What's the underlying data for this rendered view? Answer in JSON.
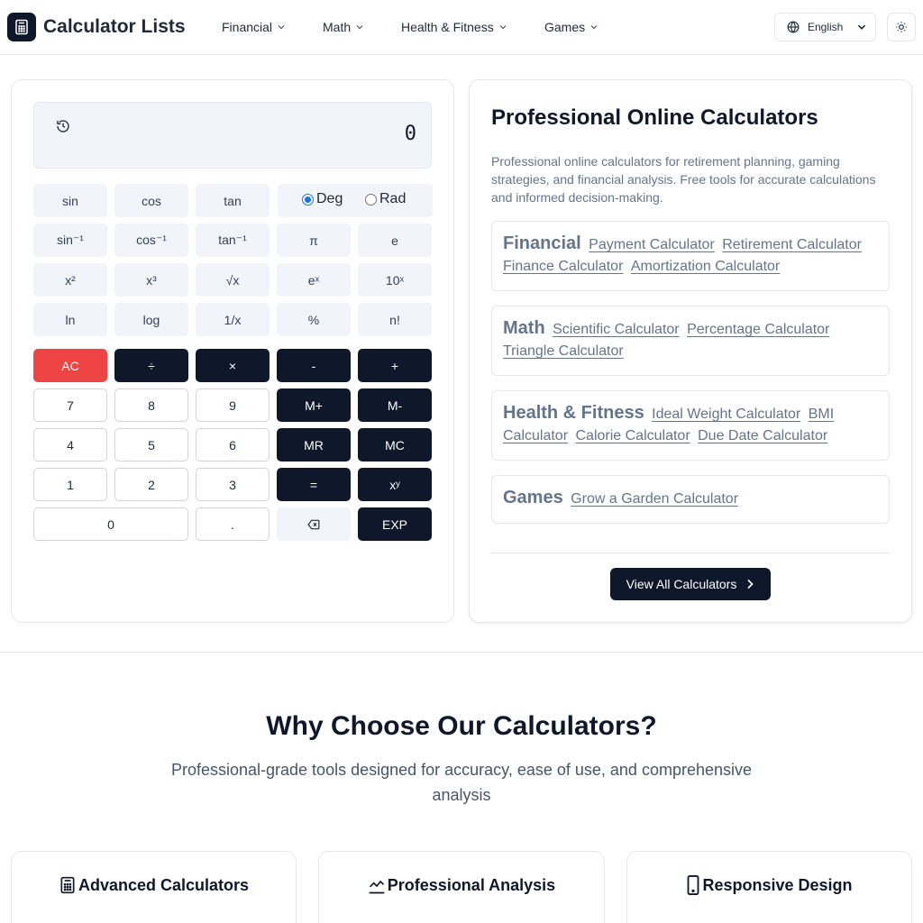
{
  "header": {
    "brand": "Calculator Lists",
    "nav": [
      {
        "label": "Financial"
      },
      {
        "label": "Math"
      },
      {
        "label": "Health & Fitness"
      },
      {
        "label": "Games"
      }
    ],
    "language": "English"
  },
  "calculator": {
    "display": "0",
    "angle_modes": {
      "deg": "Deg",
      "rad": "Rad",
      "selected": "Deg"
    },
    "keys": {
      "sin": "sin",
      "cos": "cos",
      "tan": "tan",
      "asin": "sin⁻¹",
      "acos": "cos⁻¹",
      "atan": "tan⁻¹",
      "pi": "π",
      "e": "e",
      "sq": "x²",
      "cube": "x³",
      "sqrt": "√x",
      "exp_e": "eˣ",
      "ten_pow": "10ˣ",
      "ln": "ln",
      "log": "log",
      "inv": "1/x",
      "pct": "%",
      "fact": "n!",
      "ac": "AC",
      "div": "÷",
      "mul": "×",
      "sub": "-",
      "add": "+",
      "n7": "7",
      "n8": "8",
      "n9": "9",
      "mplus": "M+",
      "mminus": "M-",
      "n4": "4",
      "n5": "5",
      "n6": "6",
      "mr": "MR",
      "mc": "MC",
      "n1": "1",
      "n2": "2",
      "n3": "3",
      "eq": "=",
      "pow": "xʸ",
      "n0": "0",
      "dot": ".",
      "expk": "EXP"
    }
  },
  "info": {
    "title": "Professional Online Calculators",
    "description": "Professional online calculators for retirement planning, gaming strategies, and financial analysis. Free tools for accurate calculations and informed decision-making.",
    "categories": [
      {
        "title": "Financial",
        "links": [
          "Payment Calculator",
          "Retirement Calculator",
          "Finance Calculator",
          "Amortization Calculator"
        ]
      },
      {
        "title": "Math",
        "links": [
          "Scientific Calculator",
          "Percentage Calculator",
          "Triangle Calculator"
        ]
      },
      {
        "title": "Health & Fitness",
        "links": [
          "Ideal Weight Calculator",
          "BMI Calculator",
          "Calorie Calculator",
          "Due Date Calculator"
        ]
      },
      {
        "title": "Games",
        "links": [
          "Grow a Garden Calculator"
        ]
      }
    ],
    "view_all": "View All Calculators"
  },
  "why": {
    "title": "Why Choose Our Calculators?",
    "subtitle": "Professional-grade tools designed for accuracy, ease of use, and comprehensive analysis",
    "features": [
      {
        "title": "Advanced Calculators",
        "icon": "calculator-icon"
      },
      {
        "title": "Professional Analysis",
        "icon": "trend-line-icon"
      },
      {
        "title": "Responsive Design",
        "icon": "smartphone-icon"
      }
    ]
  },
  "colors": {
    "primary": "#0f172a",
    "danger": "#ef4444",
    "muted": "#64748b",
    "border": "#e5e7eb",
    "radio_accent": "#1a73e8"
  }
}
